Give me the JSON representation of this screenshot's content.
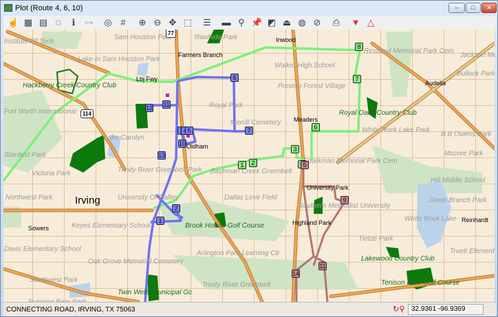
{
  "window": {
    "title": "Plot (Route 4, 6, 10)",
    "minimize": "–",
    "maximize": "□",
    "close": "✕"
  },
  "toolbar": [
    {
      "icon": "pan-hand-icon",
      "glyph": "☝"
    },
    {
      "icon": "map-view-icon",
      "glyph": "▦"
    },
    {
      "icon": "route-map-icon",
      "glyph": "▤"
    },
    {
      "icon": "copy-icon",
      "glyph": "⧉",
      "disabled": true
    },
    {
      "icon": "info-edit-icon",
      "glyph": "ℹ"
    },
    {
      "icon": "link-icon",
      "glyph": "⊶",
      "disabled": true
    },
    {
      "icon": "target-icon",
      "glyph": "◎"
    },
    {
      "icon": "grid-icon",
      "glyph": "#"
    },
    {
      "icon": "zoom-in-icon",
      "glyph": "⊕"
    },
    {
      "icon": "zoom-out-icon",
      "glyph": "⊖"
    },
    {
      "icon": "pan-center-icon",
      "glyph": "✥"
    },
    {
      "icon": "zoom-window-icon",
      "glyph": "⬚"
    },
    {
      "icon": "list-icon",
      "glyph": "☰"
    },
    {
      "icon": "ruler-icon",
      "glyph": "▬"
    },
    {
      "icon": "find-icon",
      "glyph": "⚲"
    },
    {
      "icon": "pushpin-icon",
      "glyph": "📌"
    },
    {
      "icon": "layers-icon",
      "glyph": "◩"
    },
    {
      "icon": "upload-icon",
      "glyph": "⏏"
    },
    {
      "icon": "globe-route-icon",
      "glyph": "◍"
    },
    {
      "icon": "globe-clear-icon",
      "glyph": "⊘"
    },
    {
      "icon": "print-icon",
      "glyph": "⎙"
    },
    {
      "icon": "move-down-icon",
      "glyph": "▼",
      "color": "#e03030"
    },
    {
      "icon": "move-up-icon",
      "glyph": "△",
      "color": "#e03030"
    }
  ],
  "colors": {
    "route_blue": "#6d72f2",
    "route_green": "#7cf07a",
    "route_red": "#b27474",
    "highway": "#e59a4a",
    "park": "#cfe4c4",
    "golf": "#0c7a0c",
    "water": "#b9d3ea"
  },
  "map": {
    "shields": [
      "77",
      "114"
    ],
    "labels": {
      "sam_houston_park": "Sam Houston Park",
      "institute_of_tech": "Institute Of Tech",
      "lake_sam_houston": "Lake In Sam Houston Park",
      "farmers_branch": "Farmers Branch",
      "lbj_fwy": "Lbj Fwy",
      "hackberry": "Hackberry Creek Country Club",
      "fort_worth": "Fort Worth International",
      "royal_park": "Royal Park",
      "merrill": "Merrill Cemetery",
      "lake_carolyn": "Lake Carolyn",
      "oldham": "Oldham",
      "stardust": "Stardust Park",
      "rawhide": "Rawhide Park",
      "inwood": "Inwood",
      "walker": "Walker High School",
      "preston": "Preston Forest Village",
      "meaders": "Meaders",
      "royal_oaks": "Royal Oaks Country Club",
      "white_rock_park": "White Rock Lake Park",
      "audelia": "Audelia",
      "restland": "Restland Memorial Park Cem",
      "jackson": "Jackson Meadows",
      "bullock": "Bullock Park",
      "bb_owens": "B B Owens Park",
      "mccree": "Mccree Park",
      "memorial_cem": "Sparkman Memorial Park Cem",
      "trinity_greenbelt_park": "Trinity River Greenbelt Park",
      "victoria": "Victoria Park",
      "northwest": "Northwest Park",
      "u_dallas": "University Of Dallas",
      "irving": "Irving",
      "bachman": "Bachman Creek Greenbelt",
      "love_field": "Dallas Love Field",
      "sowers": "Sowers",
      "keyes": "Keyes Elementary School",
      "brook_hollow": "Brook Hollow Golf Course",
      "davis": "Davis Elementary School",
      "oak_grove": "Oak Grove Memorial Cemetery",
      "arlington": "Arlington Park Learning Ctr",
      "southwest": "Southwest Park",
      "twin_wells": "Twin Wells Municipal Gc",
      "trinity_greenbelt": "Trinity River Greenbelt",
      "running_bear": "Running Bear Park",
      "university_park": "University Park",
      "smu": "Southern Methodist University",
      "highland_park": "Highland Park",
      "white_rock_lake": "White Rock Lake",
      "reinhardt": "Reinhardt",
      "hill": "Hill Middle School",
      "dixon": "Dixon Branch Park",
      "tietze": "Tietze Park",
      "truett": "Truett Elementary",
      "lakewood": "Lakewood Country Club",
      "tenison": "Tenison Park Golf Course"
    },
    "routes": {
      "blue_stops": [
        "1",
        "2",
        "3",
        "4",
        "5",
        "6",
        "7",
        "10",
        "11",
        "12",
        "13"
      ],
      "green_stops": [
        "1",
        "2",
        "3",
        "4",
        "6",
        "7",
        "8"
      ],
      "red_stops": [
        "5",
        "9",
        "11",
        "14"
      ]
    }
  },
  "status": {
    "address": "CONNECTING ROAD, IRVING, TX 75063",
    "coordinates": "32.9361 -96.9369",
    "gps_icon": "gps-find-icon"
  }
}
